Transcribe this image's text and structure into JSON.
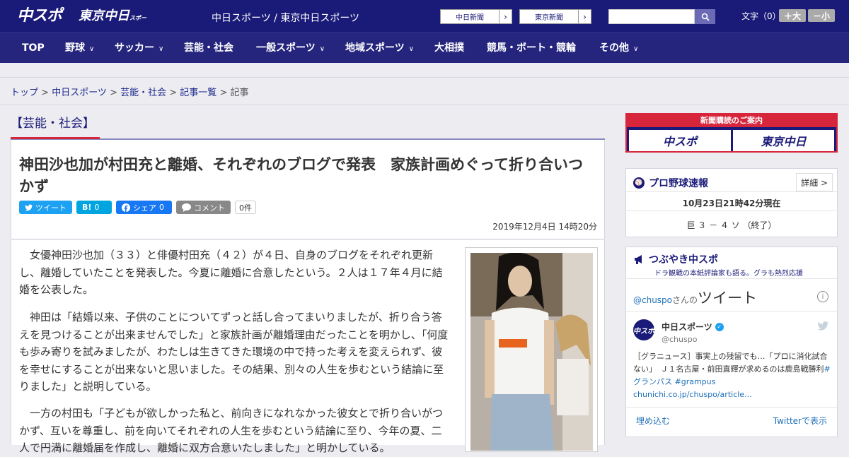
{
  "header": {
    "logo_chuspo": "中スポ",
    "logo_tokyo": "東京中日",
    "logo_tokyo_sub": "スポーツ",
    "site_links": "中日スポーツ / 東京中日スポーツ",
    "chunichi_btn": "中日新聞",
    "tokyo_btn": "東京新聞",
    "search_placeholder": "",
    "textsize_label": "文字（0）",
    "plus_label": "＋大",
    "minus_label": "－小"
  },
  "nav": [
    {
      "label": "TOP"
    },
    {
      "label": "野球"
    },
    {
      "label": "サッカー"
    },
    {
      "label": "芸能・社会"
    },
    {
      "label": "一般スポーツ"
    },
    {
      "label": "地域スポーツ"
    },
    {
      "label": "大相撲"
    },
    {
      "label": "競馬・ボート・競輪"
    },
    {
      "label": "その他"
    }
  ],
  "breadcrumb": {
    "items": [
      "トップ",
      "中日スポーツ",
      "芸能・社会",
      "記事一覧"
    ],
    "current": "記事",
    "sep": " > "
  },
  "article": {
    "category": "【芸能・社会】",
    "headline": "神田沙也加が村田充と離婚、それぞれのブログで発表　家族計画めぐって折り合いつかず",
    "share": {
      "tweet": "ツイート",
      "hatena": "B!",
      "hatena_count": "0",
      "fb": "シェア",
      "fb_count": "0",
      "comment": "コメント",
      "comment_count": "0件"
    },
    "date": "2019年12月4日 14時20分",
    "paragraphs": [
      "女優神田沙也加（３３）と俳優村田充（４２）が４日、自身のブログをそれぞれ更新し、離婚していたことを発表した。今夏に離婚に合意したという。２人は１７年４月に結婚を公表した。",
      "神田は「結婚以来、子供のことについてずっと話し合ってまいりましたが、折り合う答えを見つけることが出来ませんでした」と家族計画が離婚理由だったことを明かし、「何度も歩み寄りを試みましたが、わたしは生きてきた環境の中で持った考えを変えられず、彼を幸せにすることが出来ないと思いました。その結果、別々の人生を歩むという結論に至りました」と説明している。",
      "一方の村田も「子どもが欲しかった私と、前向きになれなかった彼女とで折り合いがつかず、互いを尊重し、前を向いてそれぞれの人生を歩むという結論に至り、今年の夏、二人で円満に離婚届を作成し、離婚に双方合意いたしました」と明かしている。"
    ]
  },
  "sidebar": {
    "ad_top": "新聞購読のご案内",
    "ad_chuspo": "中スポ",
    "ad_tokyo": "東京中日",
    "baseball": {
      "title": "プロ野球速報",
      "more": "詳細 >",
      "time": "10月23日21時42分現在",
      "result": "巨 ３ － ４ ソ （終了）"
    },
    "tweets": {
      "title": "つぶやき中スポ",
      "subtitle": "ドラ観戦の本紙評論家も語る。グラも熱烈応援",
      "handle_link": "@chuspo",
      "handle_suffix": "さんの",
      "tweet_word": "ツイート",
      "user_name": "中日スポーツ",
      "user_handle": "@chuspo",
      "tweet_text": "［グラニュース］事実上の残留でも…「プロに消化試合ない」　Ｊ１名古屋・前田直輝が求めるのは鹿島戦勝利",
      "hashtags": "#グランパス #grampus",
      "link": "chunichi.co.jp/chuspo/article…",
      "embed": "埋め込む",
      "view_on": "Twitterで表示"
    }
  },
  "colors": {
    "header_bg": "#1a1a78",
    "nav_bg": "#25257e",
    "accent_red": "#d7263b",
    "twitter_blue": "#1da1f2",
    "facebook_blue": "#1877f2",
    "hatena_blue": "#00a4de"
  }
}
